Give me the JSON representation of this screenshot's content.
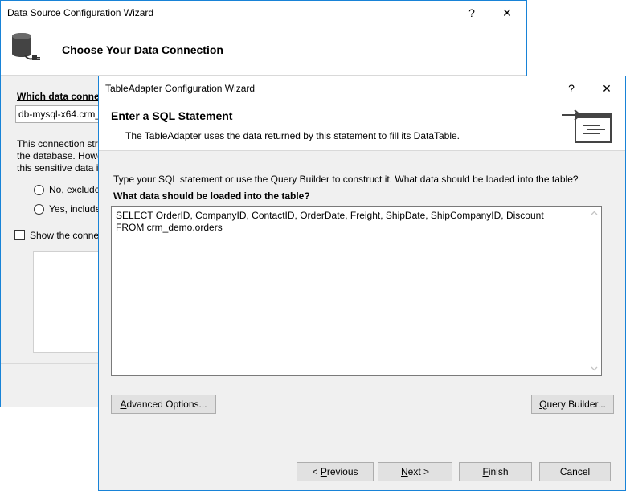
{
  "back_dialog": {
    "title": "Data Source Configuration Wizard",
    "help_glyph": "?",
    "close_glyph": "✕",
    "heading": "Choose Your Data Connection",
    "question_label": "Which data connec",
    "connection_value": "db-mysql-x64.crm_",
    "paragraph_lines": [
      "This connection str",
      "the database. Howe",
      "this sensitive data i"
    ],
    "radio_no": "No, exclude",
    "radio_yes": "Yes, include",
    "show_checkbox": "Show the conne"
  },
  "front_dialog": {
    "title": "TableAdapter Configuration Wizard",
    "help_glyph": "?",
    "close_glyph": "✕",
    "heading": "Enter a SQL Statement",
    "subheading": "The TableAdapter uses the data returned by this statement to fill its DataTable.",
    "instruction": "Type your SQL statement or use the Query Builder to construct it. What data should be loaded into the table?",
    "sql_label": "What data should be loaded into the table?",
    "sql_text": "SELECT OrderID, CompanyID, ContactID, OrderDate, Freight, ShipDate, ShipCompanyID, Discount FROM crm_demo.orders",
    "advanced_button": {
      "mnemonic": "A",
      "rest": "dvanced Options..."
    },
    "query_builder_button": {
      "mnemonic": "Q",
      "rest": "uery Builder..."
    },
    "previous_button": {
      "pre": "< ",
      "mnemonic": "P",
      "rest": "revious"
    },
    "next_button": {
      "mnemonic": "N",
      "rest": "ext >"
    },
    "finish_button": {
      "mnemonic": "F",
      "rest": "inish"
    },
    "cancel_button": "Cancel"
  },
  "colors": {
    "accent_border": "#1883d7",
    "dialog_bg": "#f0f0f0",
    "button_bg": "#e1e1e1"
  }
}
